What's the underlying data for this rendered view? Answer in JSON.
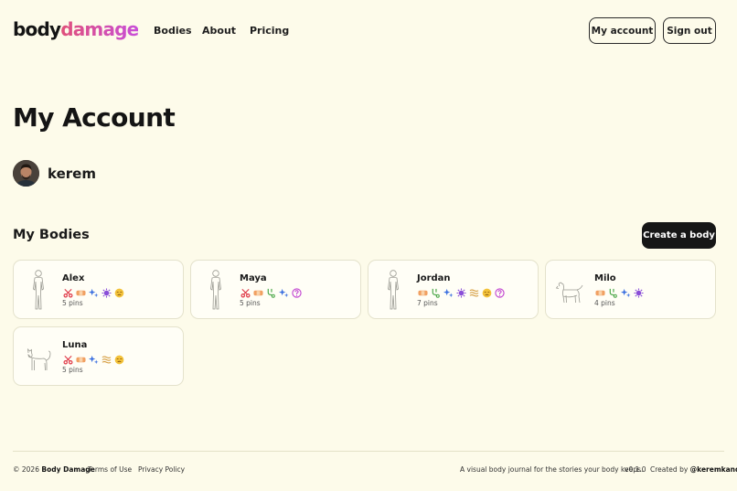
{
  "brand": {
    "part1": "body",
    "part2": "damage"
  },
  "nav": {
    "bodies": "Bodies",
    "about": "About",
    "pricing": "Pricing"
  },
  "header": {
    "my_account": "My account",
    "sign_out": "Sign out"
  },
  "page": {
    "title": "My Account"
  },
  "user": {
    "name": "kerem"
  },
  "bodies_section": {
    "title": "My Bodies",
    "create_label": "Create a body"
  },
  "bodies": [
    {
      "name": "Alex",
      "pins": "5 pins",
      "figure": "human-figure",
      "icons": [
        "scissors-icon",
        "bandage-icon",
        "sparkle-icon",
        "virus-icon",
        "tired-face-icon"
      ]
    },
    {
      "name": "Maya",
      "pins": "5 pins",
      "figure": "human-figure",
      "icons": [
        "scissors-icon",
        "bandage-icon",
        "stethoscope-icon",
        "sparkle-icon",
        "question-icon"
      ]
    },
    {
      "name": "Jordan",
      "pins": "7 pins",
      "figure": "human-figure",
      "icons": [
        "bandage-icon",
        "stethoscope-icon",
        "sparkle-icon",
        "virus-icon",
        "wavy-lines-icon",
        "tired-face-icon",
        "question-icon"
      ]
    },
    {
      "name": "Milo",
      "pins": "4 pins",
      "figure": "dog-figure",
      "icons": [
        "bandage-icon",
        "stethoscope-icon",
        "sparkle-icon",
        "virus-icon"
      ]
    },
    {
      "name": "Luna",
      "pins": "5 pins",
      "figure": "cat-figure",
      "icons": [
        "scissors-icon",
        "bandage-icon",
        "sparkle-icon",
        "wavy-lines-icon",
        "tired-face-icon"
      ]
    }
  ],
  "footer": {
    "copyright": "© 2026",
    "brand": "Body Damage",
    "terms": "Terms of Use",
    "privacy": "Privacy Policy",
    "tagline": "A visual body journal for the stories your body keeps.",
    "version": "v0.1.0",
    "created_by": "Created by",
    "author": "@keremkand"
  },
  "colors": {
    "background": "#fdfbea",
    "accent_pink": "#e0507a",
    "accent_purple": "#c84ed8",
    "button_dark": "#161616"
  }
}
